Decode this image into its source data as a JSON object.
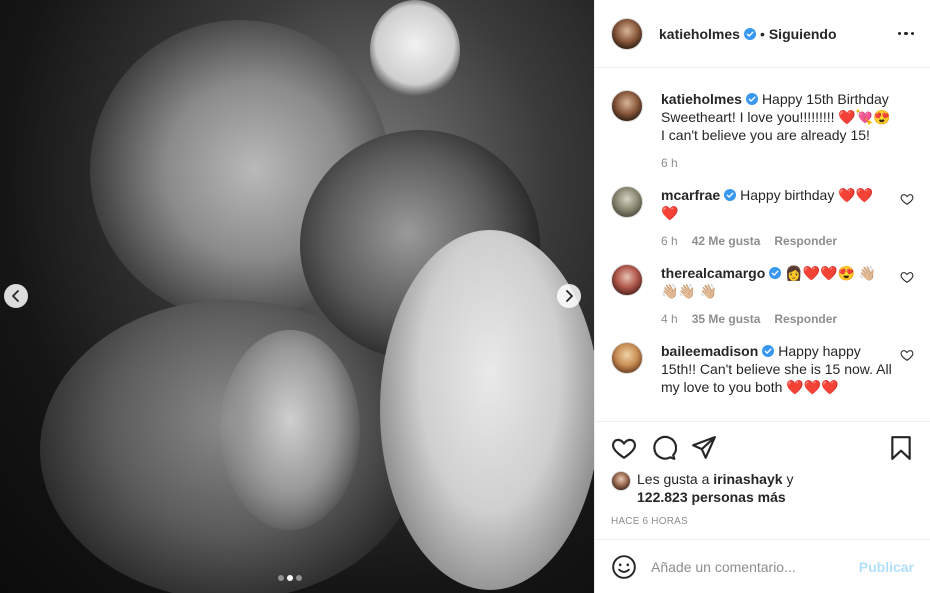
{
  "post": {
    "author": "katieholmes",
    "follow_sep": "•",
    "follow_label": "Siguiendo",
    "caption_author": "katieholmes",
    "caption_text": "Happy 15th Birthday Sweetheart! I love you!!!!!!!!! ❤️💘😍 I can't believe you are already 15!",
    "caption_time": "6 h"
  },
  "comments": [
    {
      "user": "mcarfrae",
      "text": "Happy birthday ❤️❤️ ❤️",
      "time": "6 h",
      "likes": "42 Me gusta",
      "reply": "Responder",
      "avatar_icon": "mcarfrae-avatar"
    },
    {
      "user": "therealcamargo",
      "text": "👩‍❤️❤️😍 👋🏼👋🏼👋🏼 👋🏼",
      "time": "4 h",
      "likes": "35 Me gusta",
      "reply": "Responder",
      "avatar_icon": "therealcamargo-avatar"
    },
    {
      "user": "baileemadison",
      "text": "Happy happy 15th!! Can't believe she is 15 now. All my love to you both ❤️❤️❤️",
      "time": "",
      "likes": "",
      "reply": "",
      "avatar_icon": "baileemadison-avatar"
    }
  ],
  "likes": {
    "prefix": "Les gusta a",
    "liker": "irinashayk",
    "conj": "y",
    "count": "122.823 personas más"
  },
  "timeago": "HACE 6 HORAS",
  "add_comment": {
    "placeholder": "Añade un comentario...",
    "publish_label": "Publicar"
  },
  "carousel": {
    "total": 3,
    "active": 2
  },
  "colors": {
    "verified": "#3897f0",
    "heart": "#c2272d",
    "publish": "#b2dffc",
    "meta": "#8e8e8e"
  }
}
